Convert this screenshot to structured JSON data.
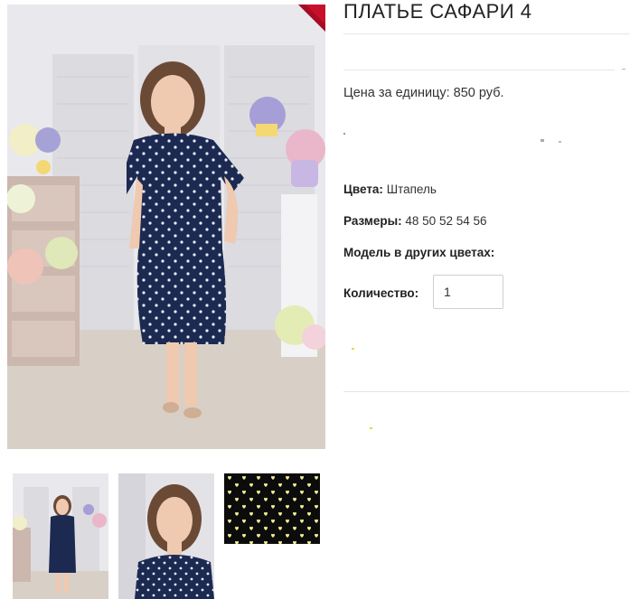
{
  "product": {
    "title": "ПЛАТЬЕ САФАРИ 4",
    "price_label": "Цена за единицу:",
    "price_value": "850 руб.",
    "colors_label": "Цвета:",
    "colors_value": "Штапель",
    "sizes_label": "Размеры:",
    "sizes_value": "48 50 52 54 56",
    "other_colors_label": "Модель в других цветах:",
    "quantity_label": "Количество:",
    "quantity_value": "1"
  },
  "colors": {
    "dress": "#1c2a52",
    "badge": "#c8102e",
    "fabric": "#0c0c0c",
    "heart": "#f3ee96"
  },
  "thumbnails": [
    {
      "icon": "full-length-photo"
    },
    {
      "icon": "portrait-photo"
    },
    {
      "icon": "fabric-swatch"
    }
  ]
}
